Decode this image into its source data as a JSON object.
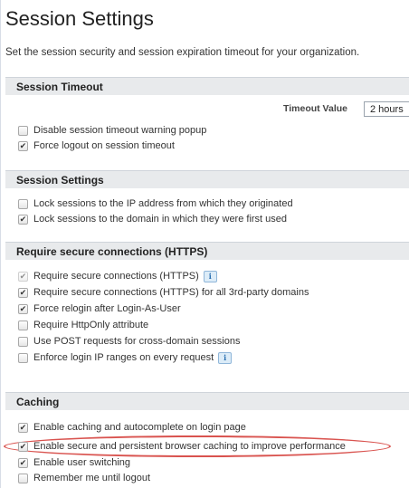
{
  "page": {
    "title": "Session Settings",
    "subtitle": "Set the session security and session expiration timeout for your organization."
  },
  "sections": {
    "session_timeout": {
      "header": "Session Timeout",
      "timeout_label": "Timeout Value",
      "timeout_value": "2 hours",
      "items": [
        {
          "label": "Disable session timeout warning popup",
          "checked": false
        },
        {
          "label": "Force logout on session timeout",
          "checked": true
        }
      ]
    },
    "session_settings": {
      "header": "Session Settings",
      "items": [
        {
          "label": "Lock sessions to the IP address from which they originated",
          "checked": false
        },
        {
          "label": "Lock sessions to the domain in which they were first used",
          "checked": true
        }
      ]
    },
    "https": {
      "header": "Require secure connections (HTTPS)",
      "items": [
        {
          "label": "Require secure connections (HTTPS)",
          "checked": true,
          "disabled": true,
          "info": "i"
        },
        {
          "label": "Require secure connections (HTTPS) for all 3rd-party domains",
          "checked": true
        },
        {
          "label": "Force relogin after Login-As-User",
          "checked": true
        },
        {
          "label": "Require HttpOnly attribute",
          "checked": false
        },
        {
          "label": "Use POST requests for cross-domain sessions",
          "checked": false
        },
        {
          "label": "Enforce login IP ranges on every request",
          "checked": false,
          "info": "i"
        }
      ]
    },
    "caching": {
      "header": "Caching",
      "items": [
        {
          "label": "Enable caching and autocomplete on login page",
          "checked": true
        },
        {
          "label": "Enable secure and persistent browser caching to improve performance",
          "checked": true,
          "highlighted": true
        },
        {
          "label": "Enable user switching",
          "checked": true
        },
        {
          "label": "Remember me until logout",
          "checked": false
        }
      ]
    }
  },
  "colors": {
    "header_bg": "#e8eaec",
    "highlight": "#d9534f",
    "info_icon": "#2a6fb0"
  }
}
